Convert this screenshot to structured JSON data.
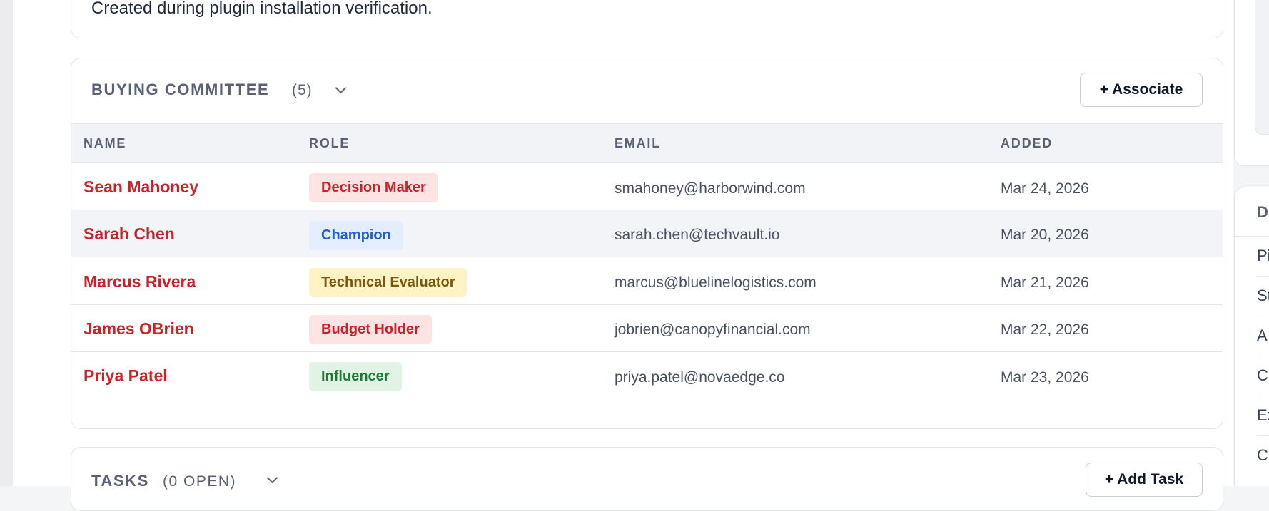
{
  "description": {
    "text": "Created during plugin installation verification."
  },
  "buying_committee": {
    "title": "BUYING COMMITTEE",
    "count": "(5)",
    "associate_label": "+ Associate",
    "columns": [
      "NAME",
      "ROLE",
      "EMAIL",
      "ADDED"
    ],
    "rows": [
      {
        "name": "Sean Mahoney",
        "role": "Decision Maker",
        "role_bg": "#fce4e4",
        "role_color": "#c8232a",
        "email": "smahoney@harborwind.com",
        "added": "Mar 24, 2026"
      },
      {
        "name": "Sarah Chen",
        "role": "Champion",
        "role_bg": "#e3edfd",
        "role_color": "#1d5fd6",
        "email": "sarah.chen@techvault.io",
        "added": "Mar 20, 2026"
      },
      {
        "name": "Marcus Rivera",
        "role": "Technical Evaluator",
        "role_bg": "#fdf3c4",
        "role_color": "#7a5a0c",
        "email": "marcus@bluelinelogistics.com",
        "added": "Mar 21, 2026"
      },
      {
        "name": "James OBrien",
        "role": "Budget Holder",
        "role_bg": "#fce4e4",
        "role_color": "#c8232a",
        "email": "jobrien@canopyfinancial.com",
        "added": "Mar 22, 2026"
      },
      {
        "name": "Priya Patel",
        "role": "Influencer",
        "role_bg": "#e1f3e4",
        "role_color": "#1f7a34",
        "email": "priya.patel@novaedge.co",
        "added": "Mar 23, 2026"
      }
    ]
  },
  "tasks": {
    "title": "TASKS",
    "count": "(0 OPEN)",
    "add_label": "+ Add Task"
  },
  "right_panel": {
    "header": "D",
    "items": [
      "Pi",
      "St",
      "A",
      "C",
      "Ex",
      "C"
    ]
  },
  "colors": {
    "link": "#c8232a",
    "muted": "#5b6172",
    "border": "#e3e5e9",
    "header_bg": "#f2f3f6"
  }
}
